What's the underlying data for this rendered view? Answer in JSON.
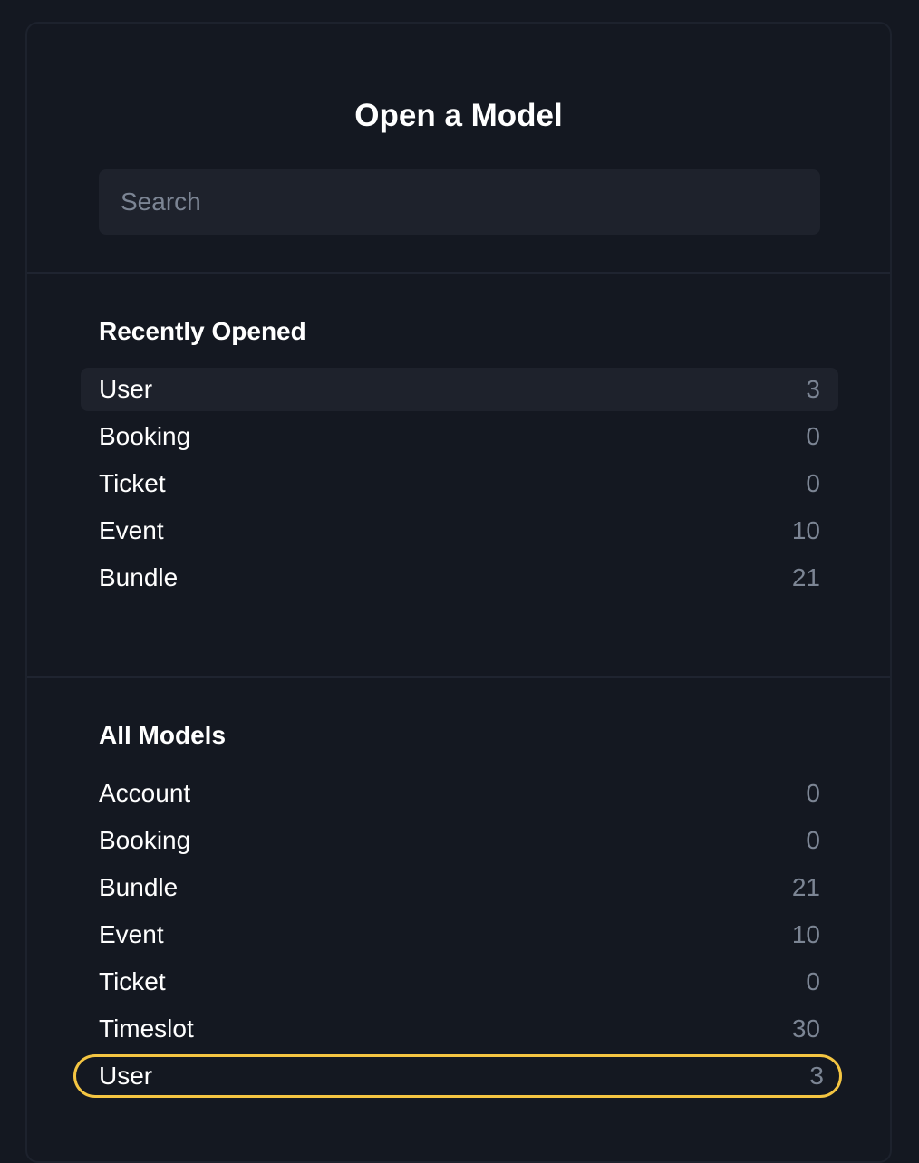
{
  "dialog": {
    "title": "Open a Model",
    "search": {
      "placeholder": "Search",
      "value": ""
    }
  },
  "recent": {
    "title": "Recently Opened",
    "items": [
      {
        "name": "User",
        "count": "3"
      },
      {
        "name": "Booking",
        "count": "0"
      },
      {
        "name": "Ticket",
        "count": "0"
      },
      {
        "name": "Event",
        "count": "10"
      },
      {
        "name": "Bundle",
        "count": "21"
      }
    ]
  },
  "all": {
    "title": "All Models",
    "items": [
      {
        "name": "Account",
        "count": "0"
      },
      {
        "name": "Booking",
        "count": "0"
      },
      {
        "name": "Bundle",
        "count": "21"
      },
      {
        "name": "Event",
        "count": "10"
      },
      {
        "name": "Ticket",
        "count": "0"
      },
      {
        "name": "Timeslot",
        "count": "30"
      },
      {
        "name": "User",
        "count": "3"
      }
    ]
  },
  "colors": {
    "background": "#141821",
    "row_highlight": "#1e222c",
    "focus_ring": "#f4c542",
    "muted_text": "#7c8594"
  }
}
